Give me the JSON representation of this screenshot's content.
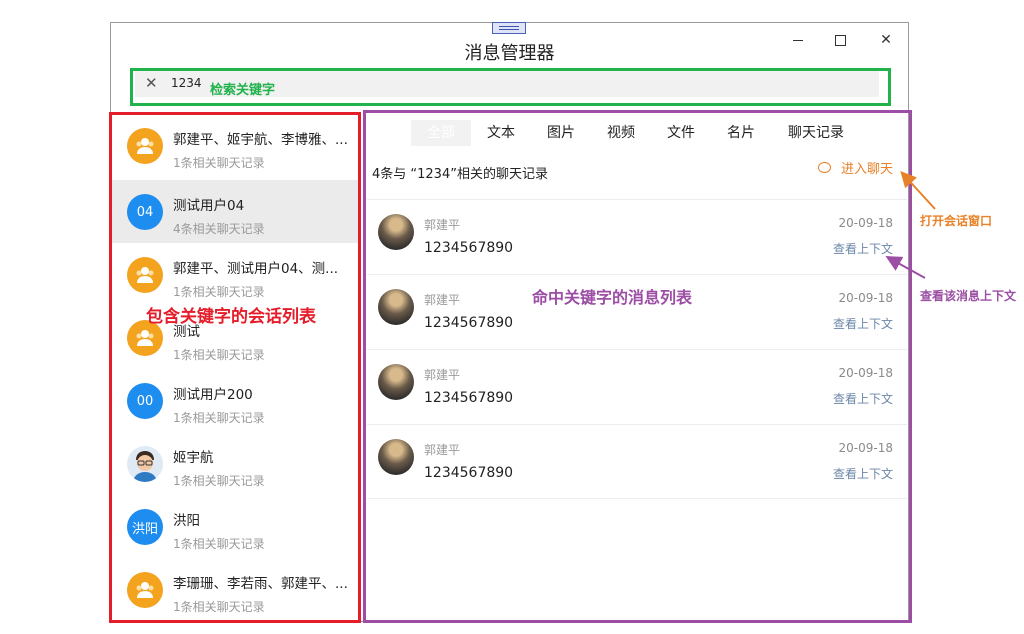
{
  "window": {
    "title": "消息管理器"
  },
  "search": {
    "query": "1234"
  },
  "annotations": {
    "search_label": "检索关键字",
    "conversation_label": "包含关键字的会话列表",
    "message_label": "命中关键字的消息列表",
    "open_chat_label": "打开会话窗口",
    "context_label": "查看该消息上下文"
  },
  "conversations": [
    {
      "name": "郭建平、姬宇航、李博雅、...",
      "sub": "1条相关聊天记录",
      "avatar": "group-icon"
    },
    {
      "name": "测试用户04",
      "sub": "4条相关聊天记录",
      "avatar_text": "04"
    },
    {
      "name": "郭建平、测试用户04、测...",
      "sub": "1条相关聊天记录",
      "avatar": "group-icon"
    },
    {
      "name": "测试",
      "sub": "1条相关聊天记录",
      "avatar": "group-icon"
    },
    {
      "name": "测试用户200",
      "sub": "1条相关聊天记录",
      "avatar_text": "00"
    },
    {
      "name": "姬宇航",
      "sub": "1条相关聊天记录",
      "avatar": "user-photo"
    },
    {
      "name": "洪阳",
      "sub": "1条相关聊天记录",
      "avatar_text": "洪阳"
    },
    {
      "name": "李珊珊、李若雨、郭建平、...",
      "sub": "1条相关聊天记录",
      "avatar": "group-icon"
    }
  ],
  "tabs": [
    "全部",
    "文本",
    "图片",
    "视频",
    "文件",
    "名片",
    "聊天记录"
  ],
  "results": {
    "summary": "4条与 “1234”相关的聊天记录",
    "enter_chat": "进入聊天"
  },
  "messages": [
    {
      "sender": "郭建平",
      "text": "1234567890",
      "date": "20-09-18",
      "context": "查看上下文"
    },
    {
      "sender": "郭建平",
      "text": "1234567890",
      "date": "20-09-18",
      "context": "查看上下文"
    },
    {
      "sender": "郭建平",
      "text": "1234567890",
      "date": "20-09-18",
      "context": "查看上下文"
    },
    {
      "sender": "郭建平",
      "text": "1234567890",
      "date": "20-09-18",
      "context": "查看上下文"
    }
  ],
  "colors": {
    "annotation_green": "#22b24c",
    "annotation_red": "#e51d2a",
    "annotation_purple": "#9b4ea3",
    "accent_orange": "#e8822a",
    "avatar_blue": "#1e8df0",
    "avatar_orange": "#f4a31f"
  }
}
